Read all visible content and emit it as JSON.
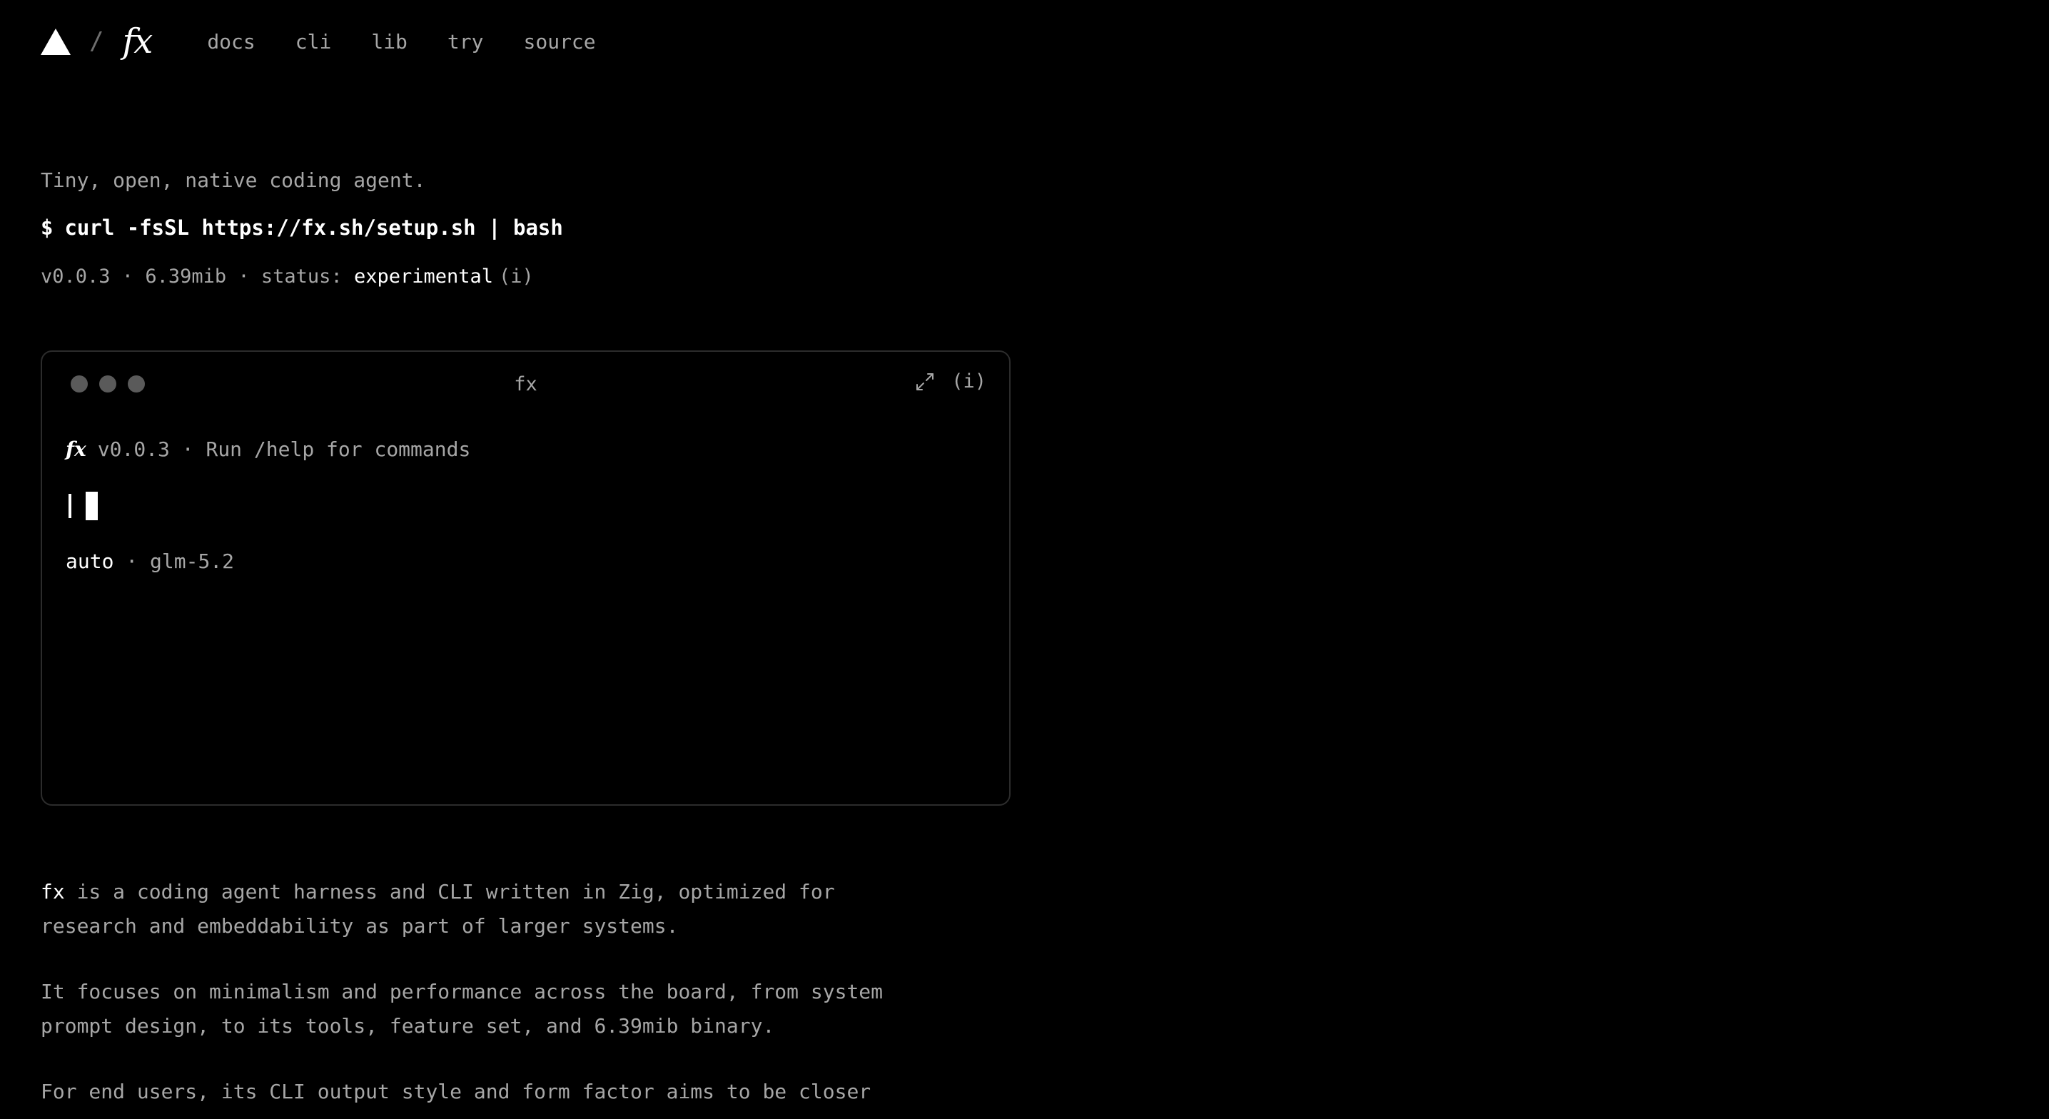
{
  "header": {
    "logo_slash": "/",
    "logo_text": "fx",
    "nav": [
      {
        "label": "docs"
      },
      {
        "label": "cli"
      },
      {
        "label": "lib"
      },
      {
        "label": "try"
      },
      {
        "label": "source"
      }
    ]
  },
  "intro": {
    "tagline": "Tiny, open, native coding agent.",
    "install_prompt": "$",
    "install_command": "curl -fsSL https://fx.sh/setup.sh | bash",
    "version": "v0.0.3",
    "separator": " · ",
    "size": "6.39mib",
    "status_label": "status: ",
    "status_value": "experimental",
    "info_link": "(i)"
  },
  "terminal": {
    "title": "fx",
    "info_button": "(i)",
    "banner_mark": "fx",
    "banner_text": "v0.0.3 · Run /help for commands",
    "mode": "auto",
    "separator": " · ",
    "model": "glm-5.2"
  },
  "description": {
    "p1_name": "fx",
    "p1_line1": " is a coding agent harness and CLI written in Zig, optimized for",
    "p1_line2": "research and embeddability as part of larger systems.",
    "p2_line1": "It focuses on minimalism and performance across the board, from system",
    "p2_line2": "prompt design, to its tools, feature set, and 6.39mib binary.",
    "p3_line1": "For end users, its CLI output style and form factor aims to be closer"
  },
  "icons": {
    "logo": "triangle-logo-icon",
    "expand": "expand-arrows-icon",
    "window_controls": "window-dot-icon"
  },
  "colors": {
    "background": "#000000",
    "text_primary": "#ffffff",
    "text_secondary": "#a6a6a6",
    "border": "#2c2c2c",
    "window_dot": "#5a5a5a"
  }
}
